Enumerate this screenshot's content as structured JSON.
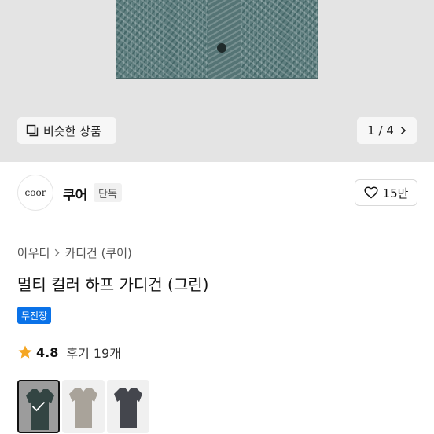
{
  "hero": {
    "similar_label": "비슷한 상품",
    "pager": "1 / 4"
  },
  "brand": {
    "logo_text": "coor",
    "name": "쿠어",
    "badge": "단독",
    "likes": "15만"
  },
  "breadcrumb": {
    "items": [
      "아우터",
      "카디건 (쿠어)"
    ]
  },
  "product": {
    "title": "멀티 컬러 하프 가디건 (그린)",
    "shipping_badge": "무진장",
    "rating": "4.8",
    "reviews": "후기 19개"
  },
  "swatches": [
    {
      "color": "#4f6b67",
      "selected": true
    },
    {
      "color": "#a9a39a",
      "selected": false
    },
    {
      "color": "#44464d",
      "selected": false
    }
  ],
  "colors": {
    "accent_blue": "#0a72e8",
    "star": "#f5a623"
  }
}
